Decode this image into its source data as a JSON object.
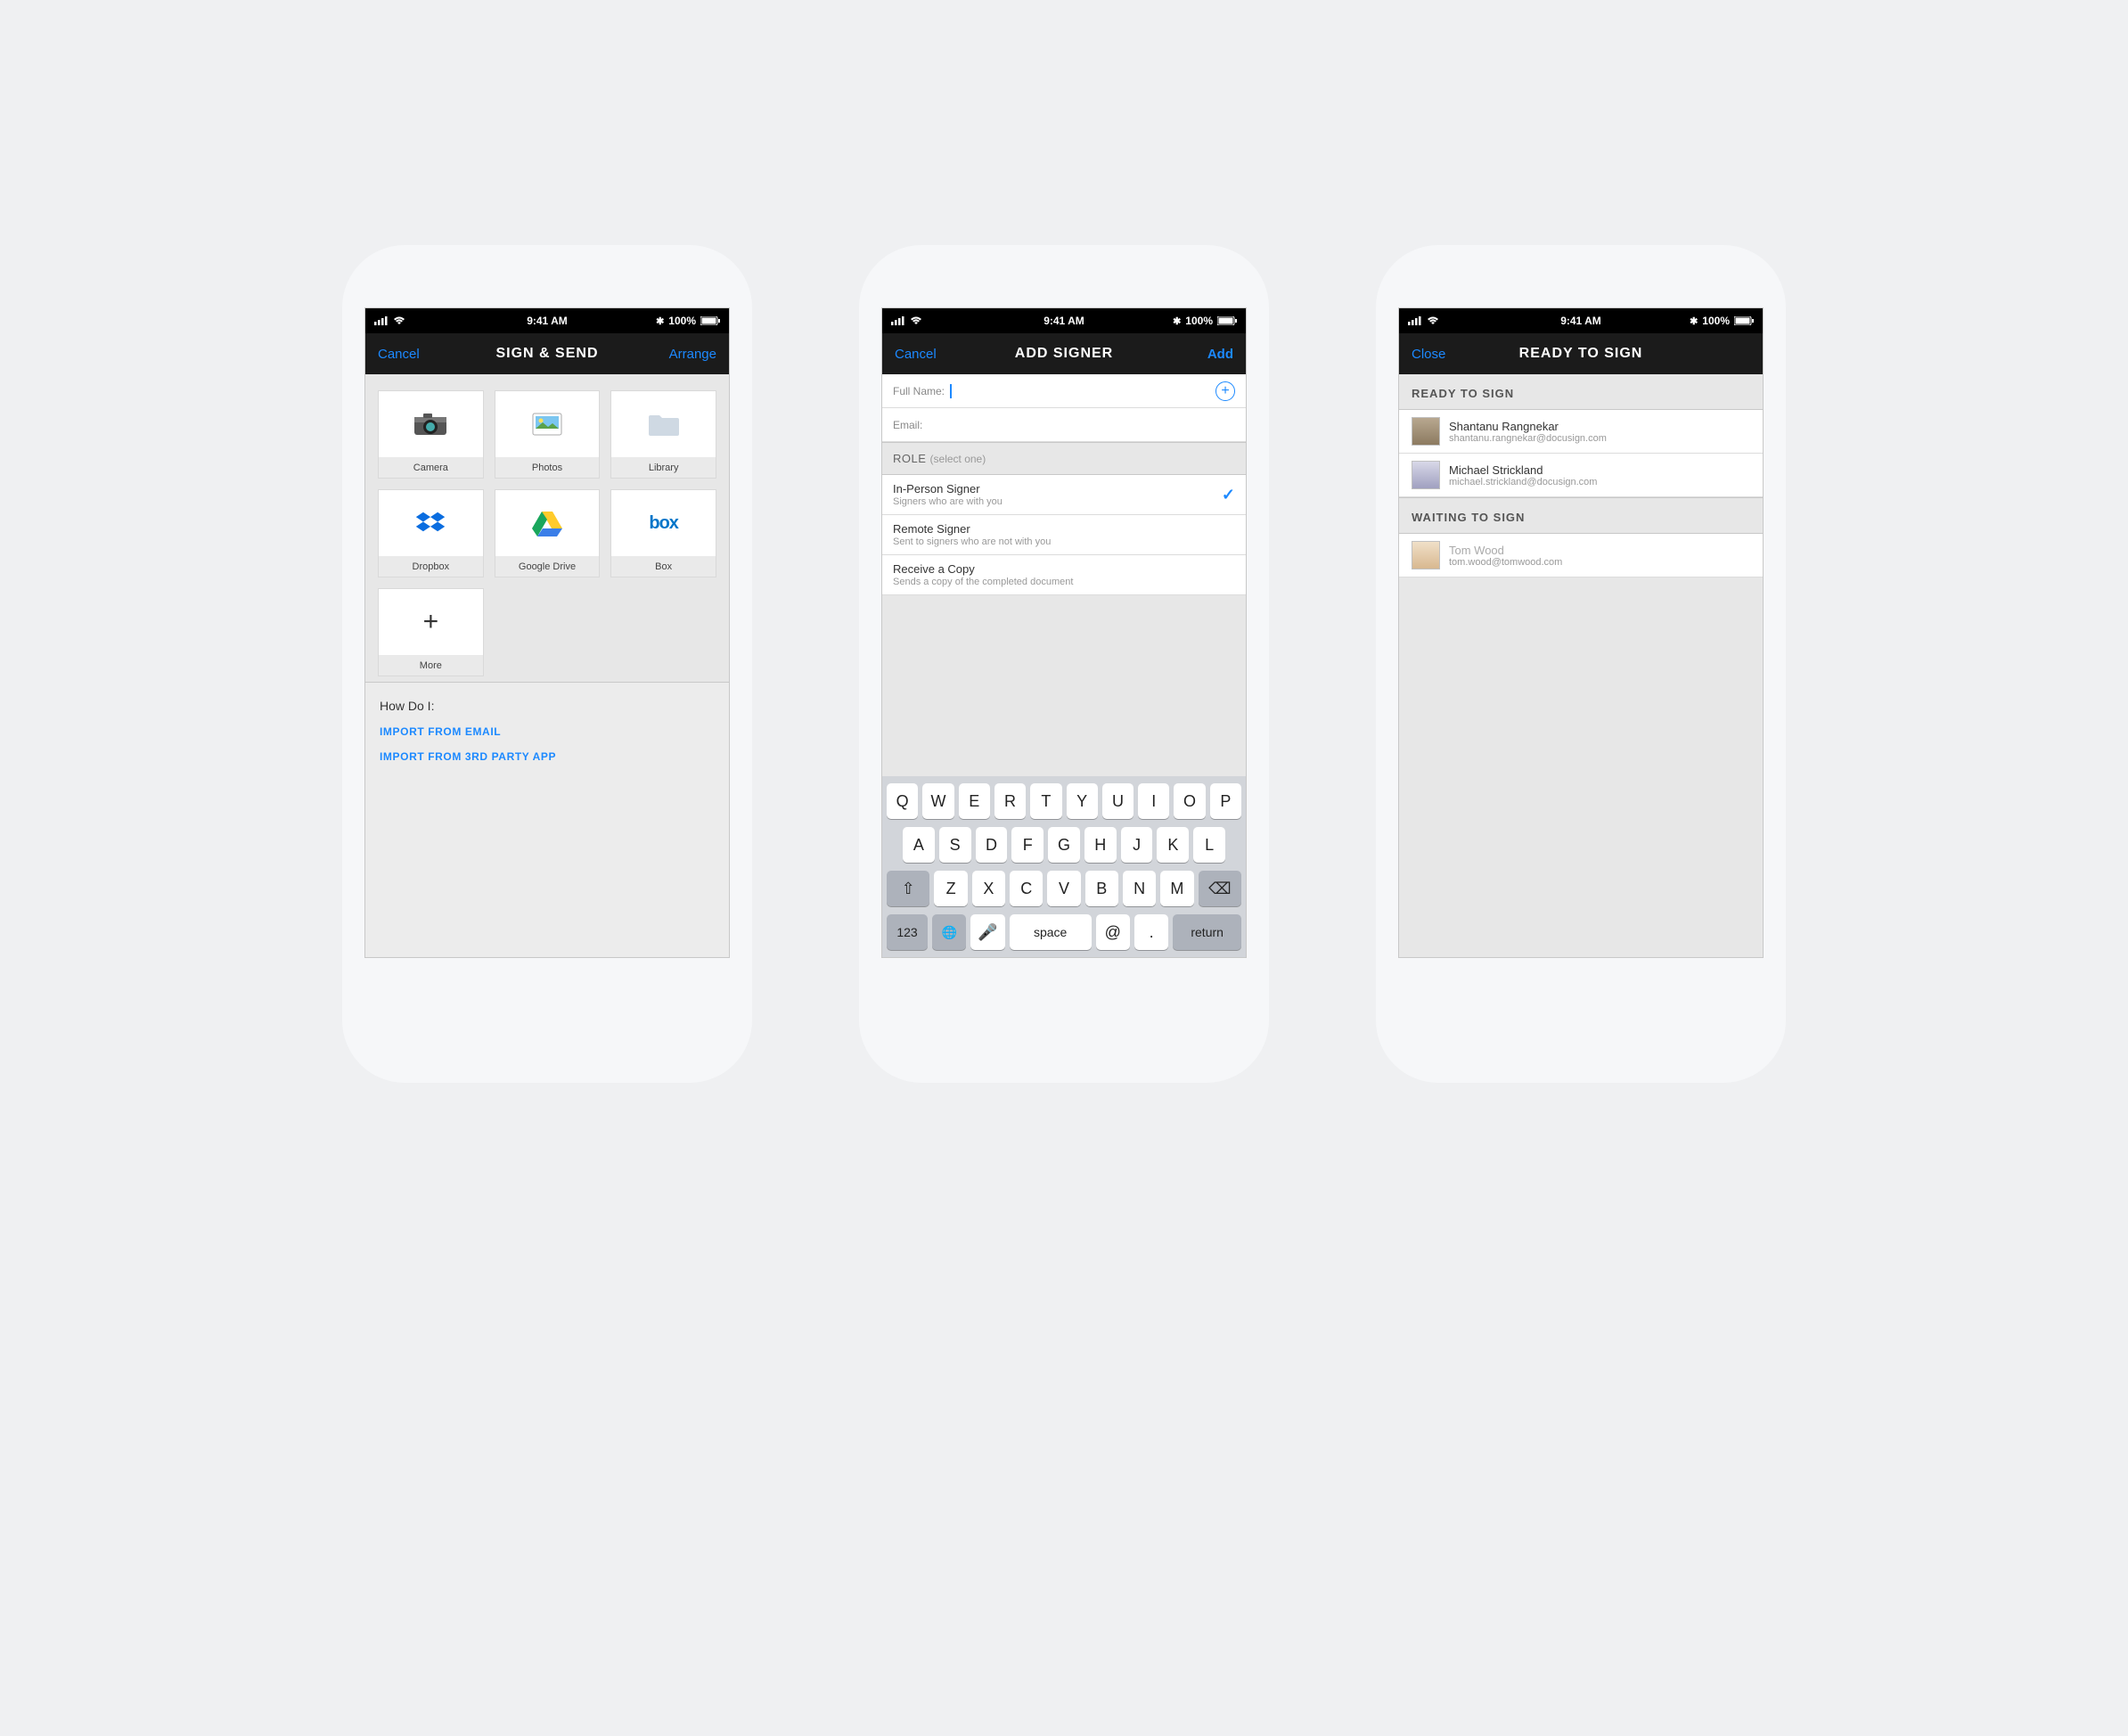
{
  "statusbar": {
    "time": "9:41 AM",
    "battery": "100%"
  },
  "screen1": {
    "nav": {
      "left": "Cancel",
      "title": "SIGN & SEND",
      "right": "Arrange"
    },
    "tiles": [
      {
        "label": "Camera"
      },
      {
        "label": "Photos"
      },
      {
        "label": "Library"
      },
      {
        "label": "Dropbox"
      },
      {
        "label": "Google Drive"
      },
      {
        "label": "Box"
      },
      {
        "label": "More"
      }
    ],
    "howdo": {
      "title": "How Do I:",
      "link1": "IMPORT FROM EMAIL",
      "link2": "IMPORT FROM 3RD PARTY APP"
    }
  },
  "screen2": {
    "nav": {
      "left": "Cancel",
      "title": "ADD SIGNER",
      "right": "Add"
    },
    "fullname_label": "Full Name:",
    "email_label": "Email:",
    "role_header": "ROLE",
    "role_sub": "(select one)",
    "roles": [
      {
        "title": "In-Person Signer",
        "desc": "Signers who are with you",
        "selected": true
      },
      {
        "title": "Remote Signer",
        "desc": "Sent to signers who are not with you",
        "selected": false
      },
      {
        "title": "Receive a Copy",
        "desc": "Sends a copy of the completed document",
        "selected": false
      }
    ],
    "keyboard": {
      "row1": [
        "Q",
        "W",
        "E",
        "R",
        "T",
        "Y",
        "U",
        "I",
        "O",
        "P"
      ],
      "row2": [
        "A",
        "S",
        "D",
        "F",
        "G",
        "H",
        "J",
        "K",
        "L"
      ],
      "row3": [
        "Z",
        "X",
        "C",
        "V",
        "B",
        "N",
        "M"
      ],
      "numkey": "123",
      "space": "space",
      "at": "@",
      "dot": ".",
      "return": "return"
    }
  },
  "screen3": {
    "nav": {
      "left": "Close",
      "title": "READY TO SIGN"
    },
    "ready_header": "READY TO SIGN",
    "waiting_header": "WAITING TO SIGN",
    "ready": [
      {
        "name": "Shantanu Rangnekar",
        "email": "shantanu.rangnekar@docusign.com"
      },
      {
        "name": "Michael Strickland",
        "email": "michael.strickland@docusign.com"
      }
    ],
    "waiting": [
      {
        "name": "Tom Wood",
        "email": "tom.wood@tomwood.com"
      }
    ]
  }
}
